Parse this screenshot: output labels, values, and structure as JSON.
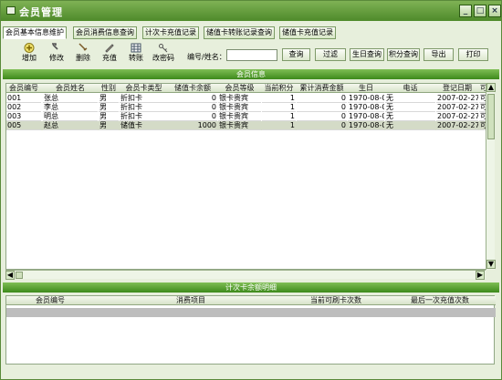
{
  "window": {
    "title": "会员管理",
    "controls": {
      "minimize": "_",
      "maximize": "□",
      "close": "×"
    }
  },
  "tabs": [
    {
      "label": "会员基本信息维护"
    },
    {
      "label": "会员消费信息查询"
    },
    {
      "label": "计次卡充值记录"
    },
    {
      "label": "储值卡转账记录查询"
    },
    {
      "label": "储值卡充值记录"
    }
  ],
  "toolbar": {
    "add": "增加",
    "edit": "修改",
    "delete": "删除",
    "recharge": "充值",
    "transfer": "转账",
    "change_password": "改密码",
    "search_label": "编号/姓名：",
    "search_value": "",
    "search_placeholder": "",
    "buttons": [
      "查询",
      "过滤",
      "生日查询",
      "积分查询",
      "导出",
      "打印"
    ]
  },
  "member_section": {
    "title": "会员信息",
    "columns": [
      "会员编号",
      "会员姓名",
      "性别",
      "会员卡类型",
      "储值卡余额",
      "会员等级",
      "当前积分",
      "累计消费金额",
      "生日",
      "电话",
      "登记日期",
      "可"
    ],
    "rows": [
      {
        "id": "001",
        "name": "张总",
        "gender": "男",
        "card_type": "折扣卡",
        "balance": "0",
        "level": "银卡贵宾",
        "points": "1",
        "total": "0",
        "birthday": "1970-08-0",
        "phone": "无",
        "date": "2007-02-27",
        "flag": "可"
      },
      {
        "id": "002",
        "name": "李总",
        "gender": "男",
        "card_type": "折扣卡",
        "balance": "0",
        "level": "银卡贵宾",
        "points": "1",
        "total": "0",
        "birthday": "1970-08-0",
        "phone": "无",
        "date": "2007-02-27",
        "flag": "可"
      },
      {
        "id": "003",
        "name": "明总",
        "gender": "男",
        "card_type": "折扣卡",
        "balance": "0",
        "level": "银卡贵宾",
        "points": "1",
        "total": "0",
        "birthday": "1970-08-0",
        "phone": "无",
        "date": "2007-02-27",
        "flag": "可"
      },
      {
        "id": "005",
        "name": "赵总",
        "gender": "男",
        "card_type": "储值卡",
        "balance": "1000",
        "level": "银卡贵宾",
        "points": "1",
        "total": "0",
        "birthday": "1970-08-0",
        "phone": "无",
        "date": "2007-02-27",
        "flag": "可"
      }
    ]
  },
  "detail_section": {
    "title": "计次卡余额明细",
    "columns": [
      "会员编号",
      "消费项目",
      "当前可刷卡次数",
      "最后一次充值次数"
    ]
  },
  "scroll": {
    "up": "▲",
    "down": "▼",
    "left": "◀",
    "right": "▶"
  }
}
